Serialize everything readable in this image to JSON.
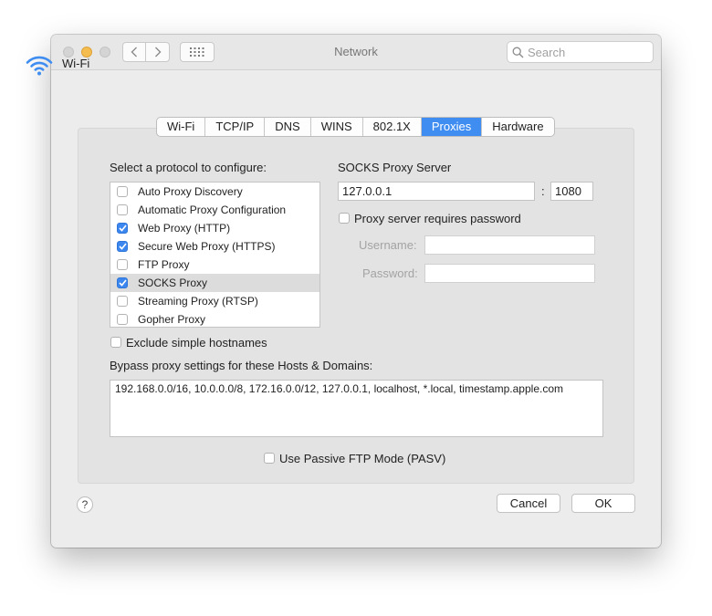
{
  "window": {
    "title": "Network"
  },
  "toolbar": {
    "back_icon": "chevron-left-icon",
    "forward_icon": "chevron-right-icon",
    "grid_icon": "grid-icon",
    "search_placeholder": "Search"
  },
  "interface": {
    "name": "Wi-Fi",
    "icon": "wifi-icon"
  },
  "tabs": [
    {
      "label": "Wi-Fi"
    },
    {
      "label": "TCP/IP"
    },
    {
      "label": "DNS"
    },
    {
      "label": "WINS"
    },
    {
      "label": "802.1X"
    },
    {
      "label": "Proxies",
      "active": true
    },
    {
      "label": "Hardware"
    }
  ],
  "protocols": {
    "heading": "Select a protocol to configure:",
    "items": [
      {
        "label": "Auto Proxy Discovery",
        "checked": false
      },
      {
        "label": "Automatic Proxy Configuration",
        "checked": false
      },
      {
        "label": "Web Proxy (HTTP)",
        "checked": true
      },
      {
        "label": "Secure Web Proxy (HTTPS)",
        "checked": true
      },
      {
        "label": "FTP Proxy",
        "checked": false
      },
      {
        "label": "SOCKS Proxy",
        "checked": true,
        "selected": true
      },
      {
        "label": "Streaming Proxy (RTSP)",
        "checked": false
      },
      {
        "label": "Gopher Proxy",
        "checked": false
      }
    ]
  },
  "server": {
    "heading": "SOCKS Proxy Server",
    "host": "127.0.0.1",
    "separator": ":",
    "port": "1080",
    "requires_password_label": "Proxy server requires password",
    "username_label": "Username:",
    "password_label": "Password:",
    "username": "",
    "password": ""
  },
  "exclude_simple": {
    "label": "Exclude simple hostnames",
    "checked": false
  },
  "bypass": {
    "heading": "Bypass proxy settings for these Hosts & Domains:",
    "value": "192.168.0.0/16, 10.0.0.0/8, 172.16.0.0/12, 127.0.0.1, localhost, *.local, timestamp.apple.com"
  },
  "passive_ftp": {
    "label": "Use Passive FTP Mode (PASV)",
    "checked": false
  },
  "buttons": {
    "help": "?",
    "cancel": "Cancel",
    "ok": "OK"
  },
  "colors": {
    "accent": "#3f8df1",
    "minimize": "#f5bd4f"
  }
}
